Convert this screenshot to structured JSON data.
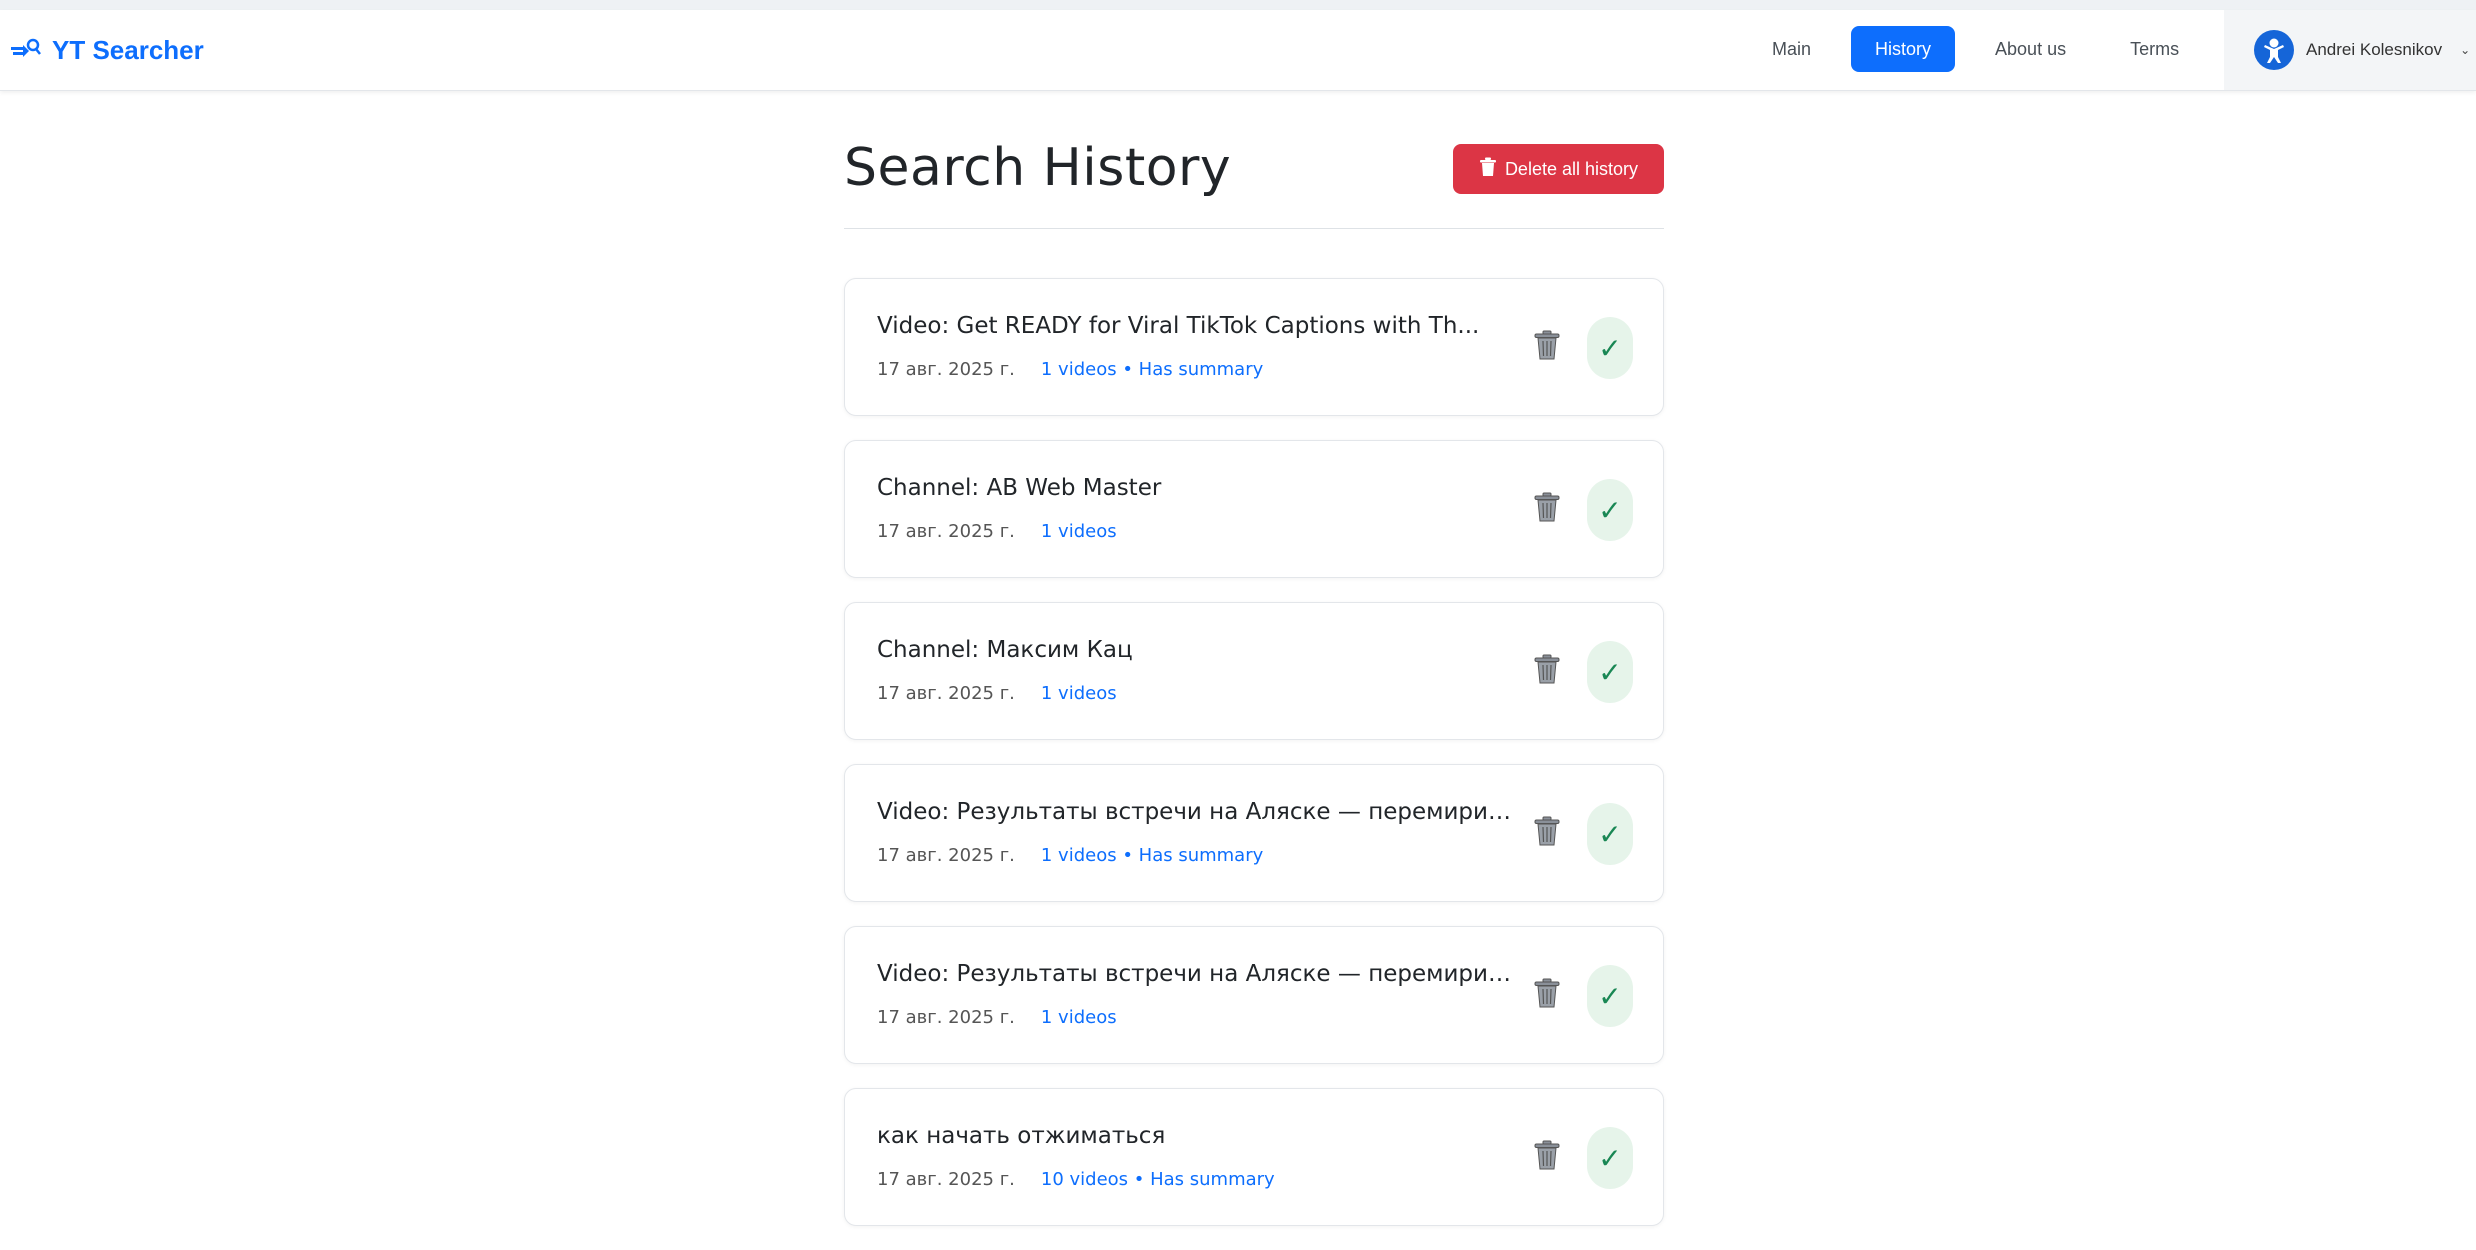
{
  "brand": {
    "name": "YT Searcher",
    "icon": "search-arrow-icon"
  },
  "nav": {
    "items": [
      {
        "label": "Main",
        "active": false
      },
      {
        "label": "History",
        "active": true
      },
      {
        "label": "About us",
        "active": false
      },
      {
        "label": "Terms",
        "active": false
      }
    ]
  },
  "user": {
    "name": "Andrei Kolesnikov",
    "icon": "avatar-icon",
    "caret": "⌄"
  },
  "page": {
    "title": "Search History",
    "delete_all_label": "Delete all history"
  },
  "history": [
    {
      "title": "Video: Get READY for Viral TikTok Captions with Th...",
      "date": "17 авг. 2025 г.",
      "info": "1 videos • Has summary"
    },
    {
      "title": "Channel: AB Web Master",
      "date": "17 авг. 2025 г.",
      "info": "1 videos"
    },
    {
      "title": "Channel: Максим Кац",
      "date": "17 авг. 2025 г.",
      "info": "1 videos"
    },
    {
      "title": "Video: Результаты встречи на Аляске — перемирия не...",
      "date": "17 авг. 2025 г.",
      "info": "1 videos • Has summary"
    },
    {
      "title": "Video: Результаты встречи на Аляске — перемирия не...",
      "date": "17 авг. 2025 г.",
      "info": "1 videos"
    },
    {
      "title": "как начать отжиматься",
      "date": "17 авг. 2025 г.",
      "info": "10 videos • Has summary"
    }
  ],
  "colors": {
    "primary": "#0d6efd",
    "danger": "#dc3545",
    "success": "#198754",
    "success_bg": "#e6f4ea"
  }
}
